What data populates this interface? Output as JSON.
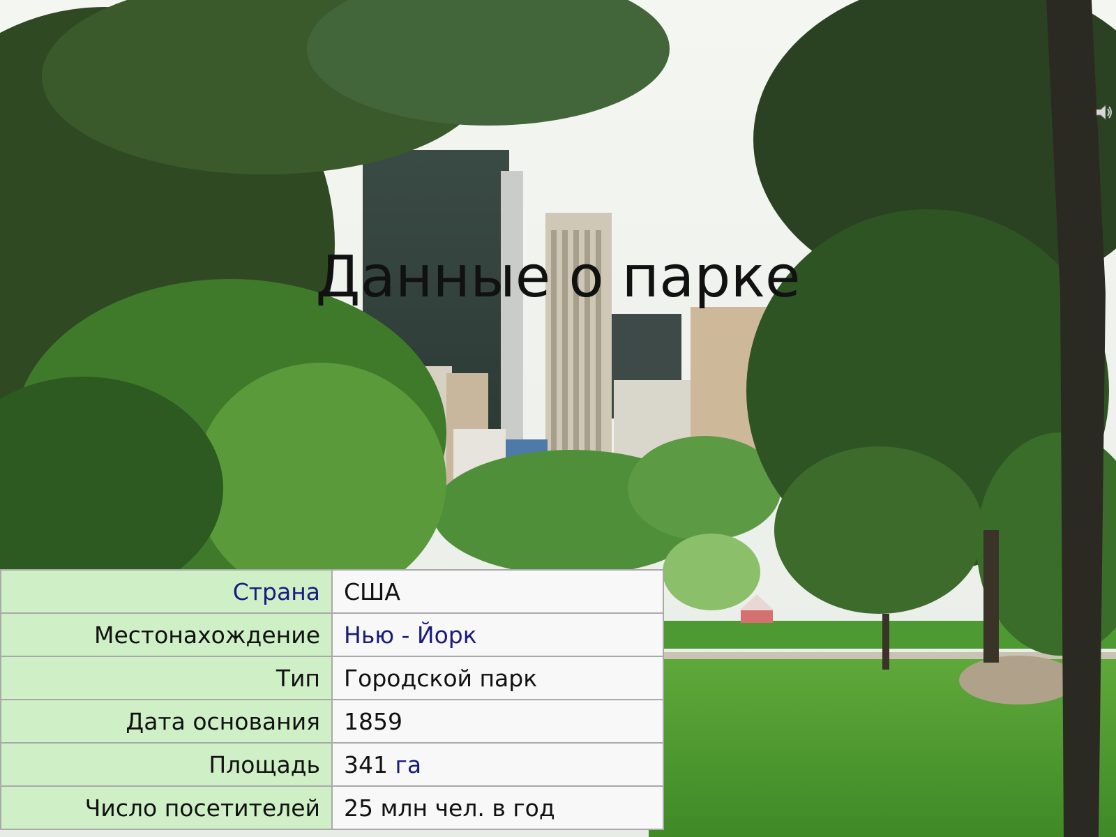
{
  "slide": {
    "title": "Данные о парке",
    "speaker_icon": "speaker-icon"
  },
  "table": {
    "rows": [
      {
        "label": "Страна",
        "label_link": true,
        "value": "США",
        "value_link": false,
        "unit": ""
      },
      {
        "label": "Местонахождение",
        "label_link": false,
        "value": "Нью - Йорк",
        "value_link": true,
        "unit": ""
      },
      {
        "label": "Тип",
        "label_link": false,
        "value": "Городской парк",
        "value_link": false,
        "unit": ""
      },
      {
        "label": "Дата основания",
        "label_link": false,
        "value": "1859",
        "value_link": false,
        "unit": ""
      },
      {
        "label": "Площадь",
        "label_link": false,
        "value": "341",
        "value_link": false,
        "unit": "га"
      },
      {
        "label": "Число посетителей",
        "label_link": false,
        "value": "25 млн чел. в год",
        "value_link": false,
        "unit": ""
      }
    ]
  },
  "colors": {
    "label_bg": "#cff0c6",
    "value_bg": "#f8f8f8",
    "link": "#1a1a80"
  }
}
